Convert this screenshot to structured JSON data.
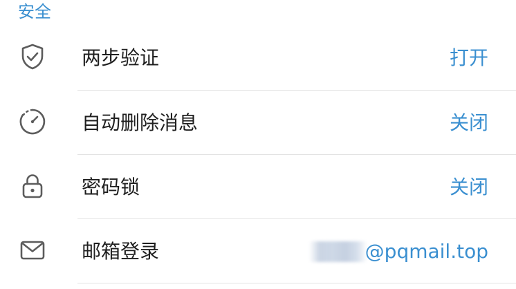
{
  "section": {
    "title": "安全"
  },
  "rows": [
    {
      "label": "两步验证",
      "value": "打开",
      "icon": "shield-check-icon"
    },
    {
      "label": "自动删除消息",
      "value": "关闭",
      "icon": "timer-icon"
    },
    {
      "label": "密码锁",
      "value": "关闭",
      "icon": "lock-icon"
    },
    {
      "label": "邮箱登录",
      "value": "@pqmail.top",
      "icon": "mail-icon"
    }
  ],
  "colors": {
    "accent": "#3a8fd0",
    "text": "#1f1f1f",
    "icon": "#5c5c5c",
    "divider": "#e3e3e3"
  }
}
